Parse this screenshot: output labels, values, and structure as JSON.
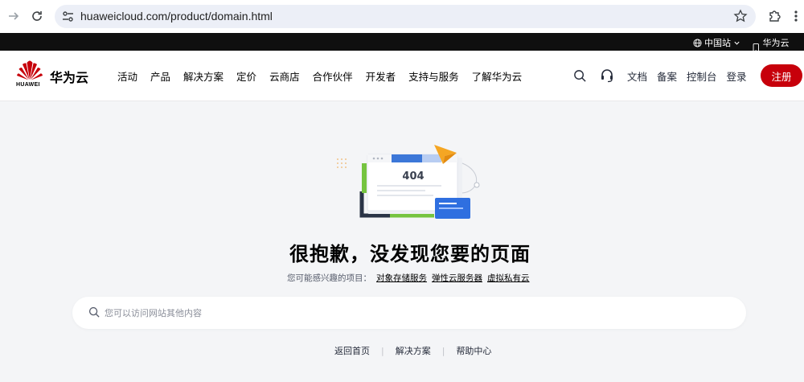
{
  "browser": {
    "url": "huaweicloud.com/product/domain.html"
  },
  "topbar": {
    "region_label": "中国站",
    "app_label": "华为云App"
  },
  "header": {
    "brand_logo_text": "HUAWEI",
    "brand_name": "华为云",
    "nav_items": [
      "活动",
      "产品",
      "解决方案",
      "定价",
      "云商店",
      "合作伙伴",
      "开发者",
      "支持与服务",
      "了解华为云"
    ],
    "right_items": {
      "docs": "文档",
      "filing": "备案",
      "console": "控制台",
      "login": "登录",
      "signup": "注册"
    }
  },
  "error_page": {
    "code": "404",
    "title": "很抱歉，没发现您要的页面",
    "suggest_prefix": "您可能感兴趣的项目：",
    "suggest_links": [
      "对象存储服务",
      "弹性云服务器",
      "虚拟私有云"
    ],
    "search_placeholder": "您可以访问网站其他内容",
    "footer_links": [
      "返回首页",
      "解决方案",
      "帮助中心"
    ]
  },
  "colors": {
    "accent": "#c7000b",
    "topstrip": "#0f0f0f",
    "background": "#f4f5f7"
  }
}
